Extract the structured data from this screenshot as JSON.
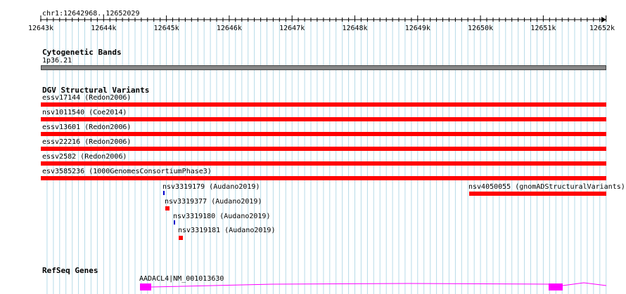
{
  "ruler": {
    "location": "chr1:12642968..12652029",
    "ticks": [
      "12643k",
      "12644k",
      "12645k",
      "12646k",
      "12647k",
      "12648k",
      "12649k",
      "12650k",
      "12651k",
      "12652k"
    ]
  },
  "tracks": {
    "cytoband": {
      "title": "Cytogenetic Bands",
      "band_label": "1p36.21",
      "band_color": "#888888"
    },
    "dgv": {
      "title": "DGV Structural Variants",
      "color": "#ff0000",
      "marker_blue": "#0000cc",
      "features": [
        {
          "label": "essv17144 (Redon2006)"
        },
        {
          "label": "nsv1011540 (Coe2014)"
        },
        {
          "label": "essv13601 (Redon2006)"
        },
        {
          "label": "essv22216 (Redon2006)"
        },
        {
          "label": "essv2582 (Redon2006)"
        },
        {
          "label": "esv3585236 (1000GenomesConsortiumPhase3)"
        },
        {
          "label": "nsv3319179 (Audano2019)"
        },
        {
          "label": "nsv4050055 (gnomADStructuralVariants)"
        },
        {
          "label": "nsv3319377 (Audano2019)"
        },
        {
          "label": "nsv3319180 (Audano2019)"
        },
        {
          "label": "nsv3319181 (Audano2019)"
        }
      ]
    },
    "refseq": {
      "title": "RefSeq Genes",
      "gene_label": "AADACL4|NM_001013630",
      "gene_color": "#ff00ff"
    }
  }
}
